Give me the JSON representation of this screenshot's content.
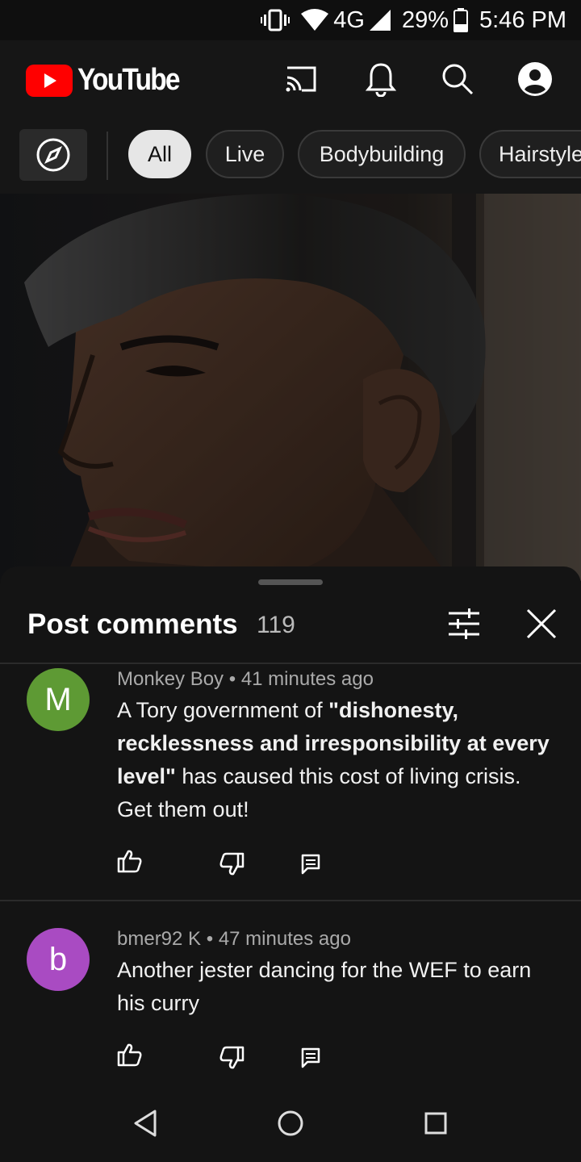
{
  "status_bar": {
    "network": "4G",
    "battery": "29%",
    "time": "5:46 PM"
  },
  "app": {
    "brand": "YouTube",
    "icons": [
      "cast-icon",
      "bell-icon",
      "search-icon",
      "account-icon"
    ]
  },
  "chips": [
    "All",
    "Live",
    "Bodybuilding",
    "Hairstyle"
  ],
  "active_chip": "All",
  "comments_sheet": {
    "title": "Post comments",
    "count": "119",
    "comments": [
      {
        "avatar_letter": "M",
        "avatar_color": "#5e9a34",
        "author": "Monkey Boy",
        "sep": "•",
        "time": "41 minutes ago",
        "text_pre": "A Tory government of ",
        "text_bold": "\"dishonesty, recklessness and irresponsibility at every level\"",
        "text_post": " has caused this cost of living crisis. Get them out!"
      },
      {
        "avatar_letter": "b",
        "avatar_color": "#a94bc2",
        "author": "bmer92 K",
        "sep": "•",
        "time": "47 minutes ago",
        "text": "Another jester dancing for the WEF to earn his curry"
      }
    ]
  },
  "colors": {
    "background": "#0f0f0f",
    "brand_red": "#ff0000",
    "sheet": "#141414"
  }
}
